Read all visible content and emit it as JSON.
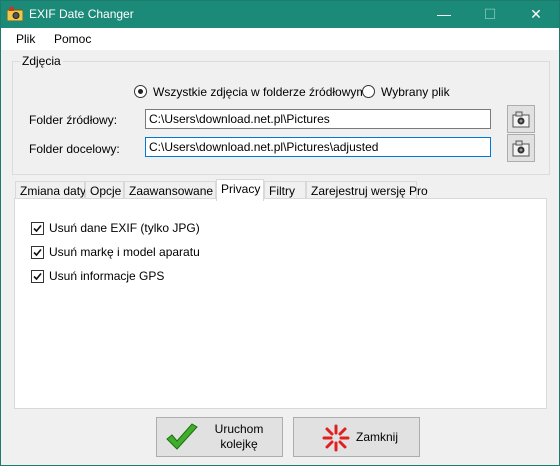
{
  "window": {
    "title": "EXIF Date Changer",
    "minimize": "—",
    "maximize": "☐",
    "close": "✕"
  },
  "menu": {
    "file": "Plik",
    "help": "Pomoc"
  },
  "photos": {
    "group_label": "Zdjęcia",
    "radio_all": "Wszystkie zdjęcia w folderze źródłowym",
    "radio_single": "Wybrany plik",
    "source_label": "Folder źródłowy:",
    "source_value": "C:\\Users\\download.net.pl\\Pictures",
    "target_label": "Folder docelowy:",
    "target_value": "C:\\Users\\download.net.pl\\Pictures\\adjusted"
  },
  "tabs": [
    "Zmiana daty",
    "Opcje",
    "Zaawansowane",
    "Privacy",
    "Filtry",
    "Zarejestruj wersję Pro"
  ],
  "privacy": {
    "remove_exif": "Usuń dane EXIF (tylko JPG)",
    "remove_camera": "Usuń markę i model aparatu",
    "remove_gps": "Usuń informacje GPS"
  },
  "buttons": {
    "run_line1": "Uruchom",
    "run_line2": "kolejkę",
    "close": "Zamknij"
  },
  "colors": {
    "titlebar": "#1b8a78",
    "focus": "#0078d7"
  }
}
